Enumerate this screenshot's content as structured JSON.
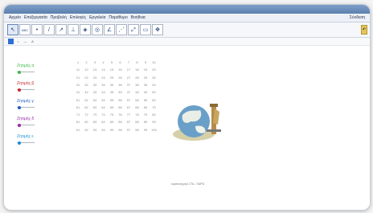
{
  "window": {
    "title": ""
  },
  "menubar": {
    "items": [
      "Αρχείο",
      "Επεξεργασία",
      "Προβολή",
      "Επιλογές",
      "Εργαλεία",
      "Παράθυρο",
      "Βοήθεια"
    ],
    "right_label": "Σύνδεση"
  },
  "toolbar": {
    "tools": [
      {
        "icon": "move-arrow-icon",
        "glyph": "↖"
      },
      {
        "icon": "abc-text-icon",
        "glyph": "ABC"
      },
      {
        "icon": "point-icon",
        "glyph": "•"
      },
      {
        "icon": "line-icon",
        "glyph": "/"
      },
      {
        "icon": "ray-icon",
        "glyph": "↗"
      },
      {
        "icon": "perpendicular-icon",
        "glyph": "⊥"
      },
      {
        "icon": "polygon-icon",
        "glyph": "◈"
      },
      {
        "icon": "circle-icon",
        "glyph": "◎"
      },
      {
        "icon": "angle-icon",
        "glyph": "∠"
      },
      {
        "icon": "reflect-icon",
        "glyph": "⋰"
      },
      {
        "icon": "transform-icon",
        "glyph": "⤢"
      },
      {
        "icon": "slider-icon",
        "glyph": "▭"
      },
      {
        "icon": "move-view-icon",
        "glyph": "✥"
      }
    ],
    "right_icon": "undo-redo-icon"
  },
  "stylebar": {
    "items": [
      {
        "icon": "color-swatch-icon",
        "glyph": "■"
      },
      {
        "icon": "point-style-icon",
        "glyph": "•"
      },
      {
        "icon": "line-style-icon",
        "glyph": "—"
      },
      {
        "icon": "label-style-icon",
        "glyph": "A"
      }
    ]
  },
  "sliders": [
    {
      "label": "Ζητιμής α",
      "color": "#3db84a"
    },
    {
      "label": "Ζητιμής β",
      "color": "#c62a2a"
    },
    {
      "label": "Ζητιμής γ",
      "color": "#1f5fbf"
    },
    {
      "label": "Ζητιμής δ",
      "color": "#9a2aa6"
    },
    {
      "label": "Ζητιμής ε",
      "color": "#1a90d8"
    }
  ],
  "number_grid": [
    [
      "1",
      "2",
      "3",
      "4",
      "5",
      "6",
      "7",
      "8",
      "9",
      "10"
    ],
    [
      "11",
      "12",
      "13",
      "14",
      "15",
      "16",
      "17",
      "18",
      "19",
      "20"
    ],
    [
      "21",
      "22",
      "23",
      "24",
      "25",
      "26",
      "27",
      "28",
      "29",
      "30"
    ],
    [
      "31",
      "32",
      "33",
      "34",
      "35",
      "36",
      "37",
      "38",
      "39",
      "40"
    ],
    [
      "41",
      "42",
      "43",
      "44",
      "45",
      "46",
      "47",
      "48",
      "49",
      "50"
    ],
    [
      "51",
      "52",
      "53",
      "54",
      "55",
      "56",
      "57",
      "58",
      "59",
      "60"
    ],
    [
      "61",
      "62",
      "63",
      "64",
      "65",
      "66",
      "67",
      "68",
      "69",
      "70"
    ],
    [
      "71",
      "72",
      "73",
      "74",
      "75",
      "76",
      "77",
      "78",
      "79",
      "80"
    ],
    [
      "81",
      "82",
      "83",
      "84",
      "85",
      "86",
      "87",
      "88",
      "89",
      "90"
    ],
    [
      "91",
      "92",
      "93",
      "94",
      "95",
      "96",
      "97",
      "98",
      "99",
      "100"
    ]
  ],
  "illustration": {
    "icon": "globe-writing-illustration",
    "caption": "καρπεταγγαςί ΣΤΑ - ΠΑΡΙΣ"
  }
}
